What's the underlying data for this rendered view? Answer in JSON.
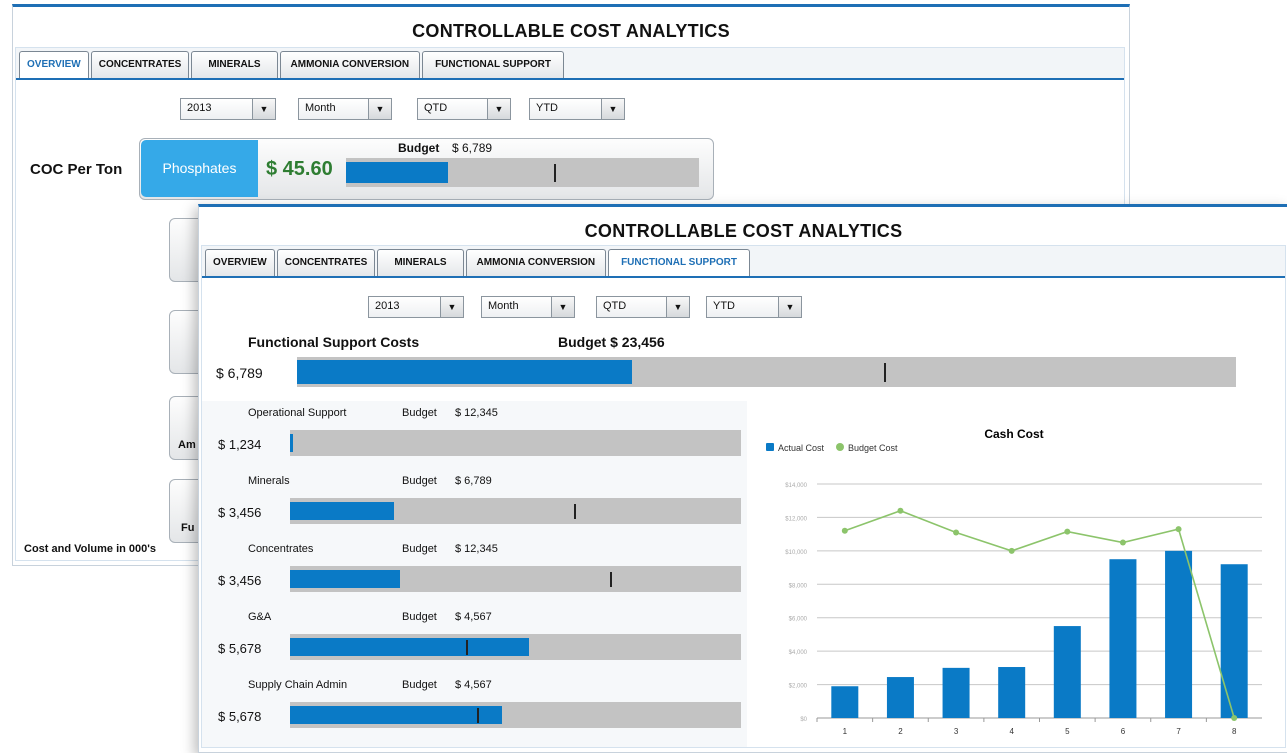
{
  "back_window": {
    "title": "CONTROLLABLE COST ANALYTICS",
    "tabs": [
      "OVERVIEW",
      "CONCENTRATES",
      "MINERALS",
      "AMMONIA CONVERSION",
      "FUNCTIONAL SUPPORT"
    ],
    "active_tab": "OVERVIEW",
    "filters": {
      "year": "2013",
      "period": "Month",
      "qtd": "QTD",
      "ytd": "YTD"
    },
    "coc_label": "COC Per Ton",
    "phosphates_button": "Phosphates",
    "phosphates_value": "$ 45.60",
    "budget_label": "Budget",
    "budget_value": "$ 6,789",
    "phosphates_actual_fraction": 0.29,
    "phosphates_budget_fraction": 0.59,
    "partial_labels": [
      "Am",
      "Fu"
    ],
    "footer": "Cost and Volume in 000's"
  },
  "front_window": {
    "title": "CONTROLLABLE COST ANALYTICS",
    "tabs": [
      "OVERVIEW",
      "CONCENTRATES",
      "MINERALS",
      "AMMONIA CONVERSION",
      "FUNCTIONAL SUPPORT"
    ],
    "active_tab": "FUNCTIONAL SUPPORT",
    "filters": {
      "year": "2013",
      "period": "Month",
      "qtd": "QTD",
      "ytd": "YTD"
    },
    "summary": {
      "label": "Functional Support Costs",
      "budget_text": "Budget $ 23,456",
      "value": "$ 6,789",
      "actual_fraction": 0.357,
      "budget_fraction": 0.625
    },
    "budget_word": "Budget",
    "items": [
      {
        "name": "Operational Support",
        "budget": "$ 12,345",
        "value": "$ 1,234",
        "actual_fraction": 0.007,
        "budget_fraction": null
      },
      {
        "name": "Minerals",
        "budget": "$ 6,789",
        "value": "$ 3,456",
        "actual_fraction": 0.23,
        "budget_fraction": 0.63
      },
      {
        "name": "Concentrates",
        "budget": "$ 12,345",
        "value": "$ 3,456",
        "actual_fraction": 0.243,
        "budget_fraction": 0.71
      },
      {
        "name": "G&A",
        "budget": "$ 4,567",
        "value": "$ 5,678",
        "actual_fraction": 0.53,
        "budget_fraction": 0.39
      },
      {
        "name": "Supply Chain Admin",
        "budget": "$ 4,567",
        "value": "$ 5,678",
        "actual_fraction": 0.47,
        "budget_fraction": 0.415
      }
    ]
  },
  "chart_data": {
    "type": "bar",
    "title": "Cash Cost",
    "categories": [
      "1",
      "2",
      "3",
      "4",
      "5",
      "6",
      "7",
      "8"
    ],
    "series": [
      {
        "name": "Actual Cost",
        "type": "bar",
        "color": "#0a7ac6",
        "values": [
          1900,
          2450,
          3000,
          3050,
          5500,
          9500,
          10000,
          9200
        ]
      },
      {
        "name": "Budget Cost",
        "type": "line",
        "color": "#8cc46b",
        "values": [
          11200,
          12400,
          11100,
          10000,
          11150,
          10500,
          11300,
          0
        ]
      }
    ],
    "ylim": [
      0,
      14000
    ],
    "yticks": [
      0,
      2000,
      4000,
      6000,
      8000,
      10000,
      12000,
      14000
    ],
    "ytick_labels": [
      "$0",
      "$2,000",
      "$4,000",
      "$6,000",
      "$8,000",
      "$10,000",
      "$12,000",
      "$14,000"
    ],
    "grid": true,
    "legend_position": "top-left"
  }
}
